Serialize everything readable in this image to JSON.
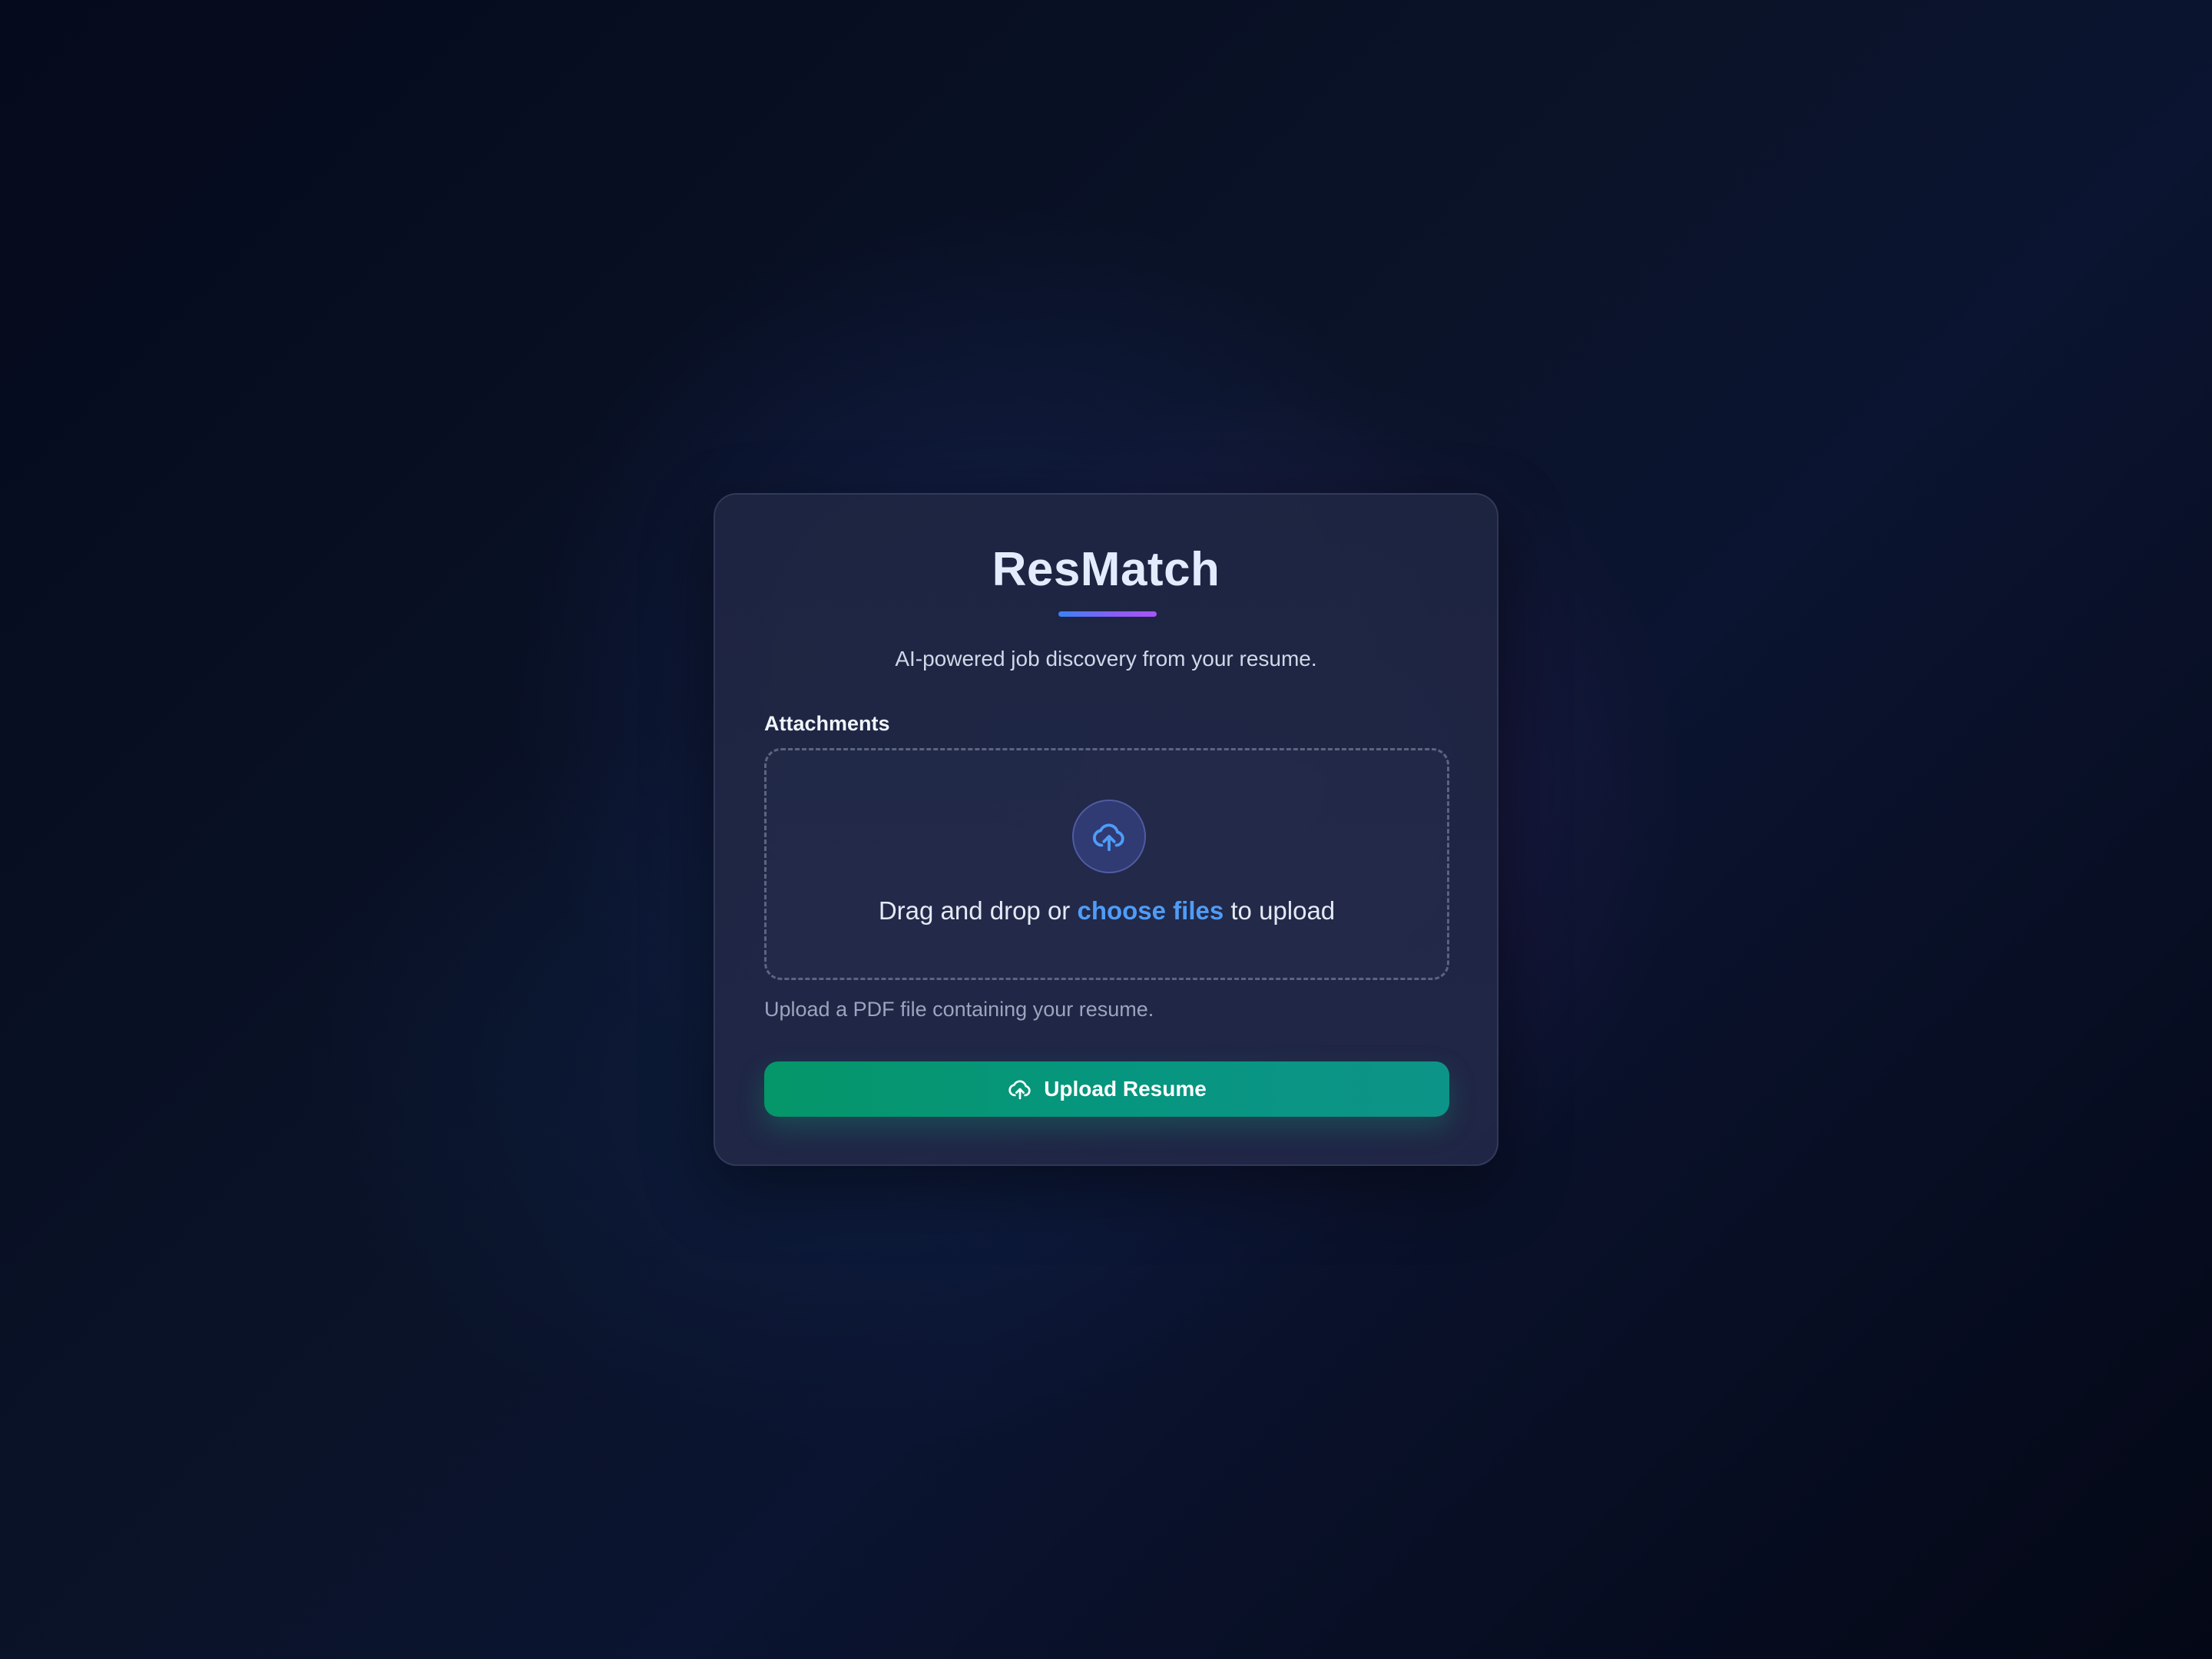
{
  "app": {
    "title": "ResMatch",
    "subtitle": "AI-powered job discovery from your resume."
  },
  "upload_form": {
    "attachments_label": "Attachments",
    "dropzone": {
      "icon": "cloud-upload-icon",
      "text_before": "Drag and drop or",
      "link_text": "choose files",
      "text_after": "to upload"
    },
    "helper_text": "Upload a PDF file containing your resume.",
    "submit_button": {
      "icon": "cloud-upload-icon",
      "label": "Upload Resume"
    }
  },
  "colors": {
    "accent_blue": "#4f9cf7",
    "button_green": "#059669",
    "underline_gradient_start": "#3b82f6",
    "underline_gradient_end": "#a855f7"
  }
}
